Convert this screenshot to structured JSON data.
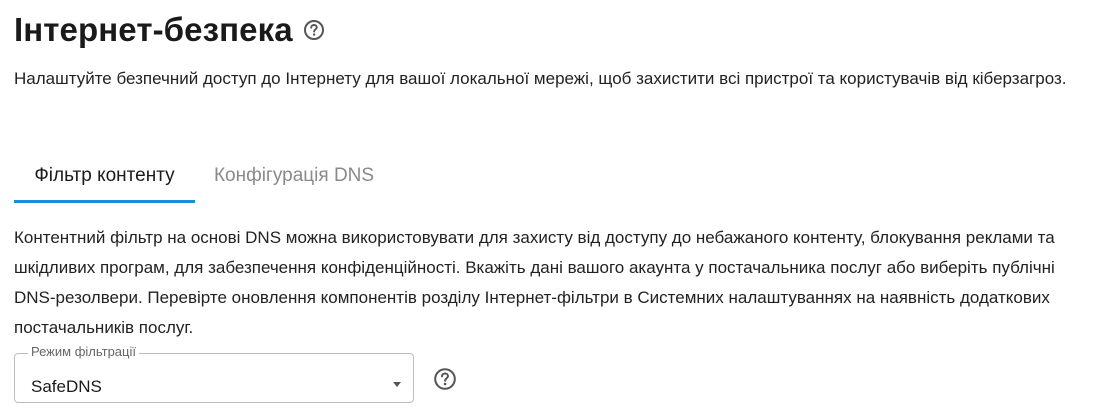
{
  "header": {
    "title": "Інтернет-безпека",
    "help_icon": "help-circle-icon"
  },
  "intro": {
    "text": "Налаштуйте безпечний доступ до Інтернету для вашої локальної мережі, щоб захистити всі пристрої та користувачів від кіберзагроз."
  },
  "tabs": [
    {
      "label": "Фільтр контенту",
      "active": true
    },
    {
      "label": "Конфігурація DNS",
      "active": false
    }
  ],
  "content": {
    "description": "Контентний фільтр на основі DNS можна використовувати для захисту від доступу до небажаного контенту, блокування реклами та шкідливих програм, для забезпечення конфіденційності. Вкажіть дані вашого акаунта у постачальника послуг або виберіть публічні DNS-резолвери. Перевірте оновлення компонентів розділу Інтернет-фільтри в Системних налаштуваннях на наявність додаткових постачальників послуг.",
    "filter_mode": {
      "label": "Режим фільтрації",
      "value": "SafeDNS",
      "help_icon": "help-circle-icon"
    }
  },
  "colors": {
    "accent": "#1a8fd4",
    "text": "#1a1a1a",
    "muted": "#8a8a8a",
    "border": "#bdbdbd"
  }
}
